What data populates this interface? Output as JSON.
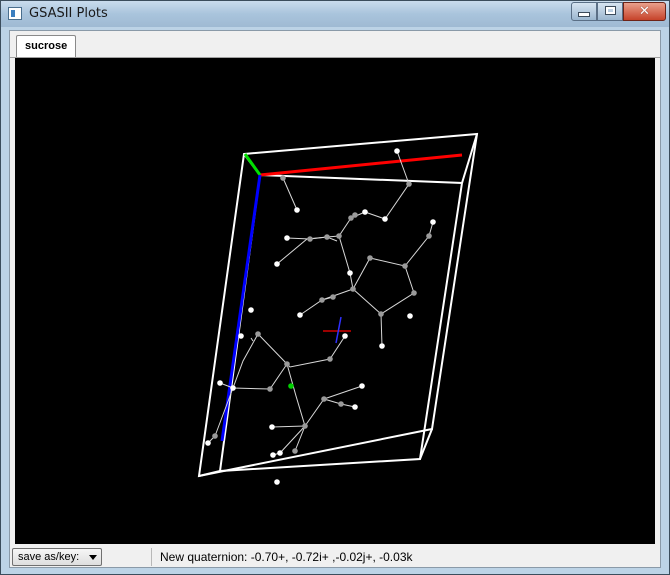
{
  "window": {
    "title": "GSASII Plots",
    "close_glyph": "✕"
  },
  "tabs": [
    {
      "label": "sucrose"
    }
  ],
  "toolbar": {
    "save_label": "save as/key:"
  },
  "status": {
    "text": "New quaternion: -0.70+, -0.72i+ ,-0.02j+, -0.03k"
  },
  "colors": {
    "axis_a": "#ff0000",
    "axis_b": "#00e000",
    "axis_c": "#0000ff",
    "cell": "#ffffff",
    "background": "#000000"
  },
  "icons": {
    "app": "gsas-window-icon",
    "minimize": "minimize-icon",
    "maximize": "maximize-icon",
    "close": "close-icon",
    "dropdown": "chevron-down-icon"
  }
}
